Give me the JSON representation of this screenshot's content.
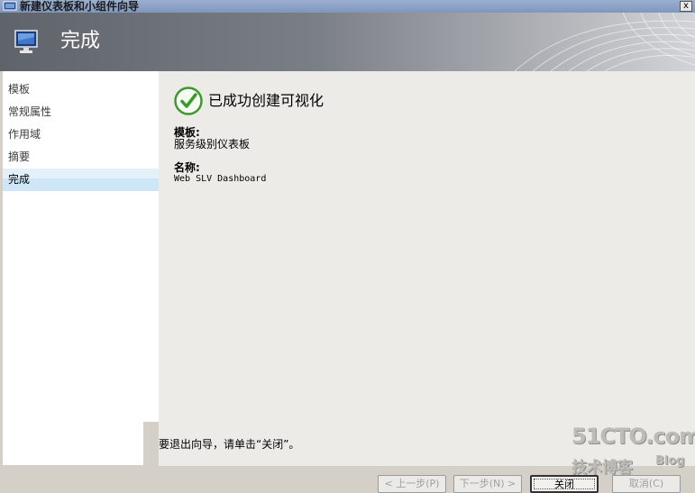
{
  "window": {
    "title": "新建仪表板和小组件向导",
    "close_glyph": "x"
  },
  "banner": {
    "title": "完成"
  },
  "sidebar": {
    "items": [
      {
        "label": "模板"
      },
      {
        "label": "常规属性"
      },
      {
        "label": "作用域"
      },
      {
        "label": "摘要"
      },
      {
        "label": "完成"
      }
    ],
    "active_index": 4
  },
  "main": {
    "success_message": "已成功创建可视化",
    "template_label": "模板:",
    "template_value": "服务级别仪表板",
    "name_label": "名称:",
    "name_value": "Web SLV Dashboard",
    "exit_instruction": "要退出向导，请单击“关闭”。"
  },
  "buttons": {
    "prev": "< 上一步(P)",
    "next": "下一步(N) >",
    "close": "关闭",
    "cancel": "取消(C)"
  },
  "watermark": {
    "site": "51CTO.com",
    "tagline": "技术博客",
    "blog": "Blog"
  },
  "colors": {
    "banner_dark": "#5f636a",
    "selection": "#cde6f8",
    "success_green": "#3a9a2a",
    "content_bg": "#ecebe8"
  }
}
